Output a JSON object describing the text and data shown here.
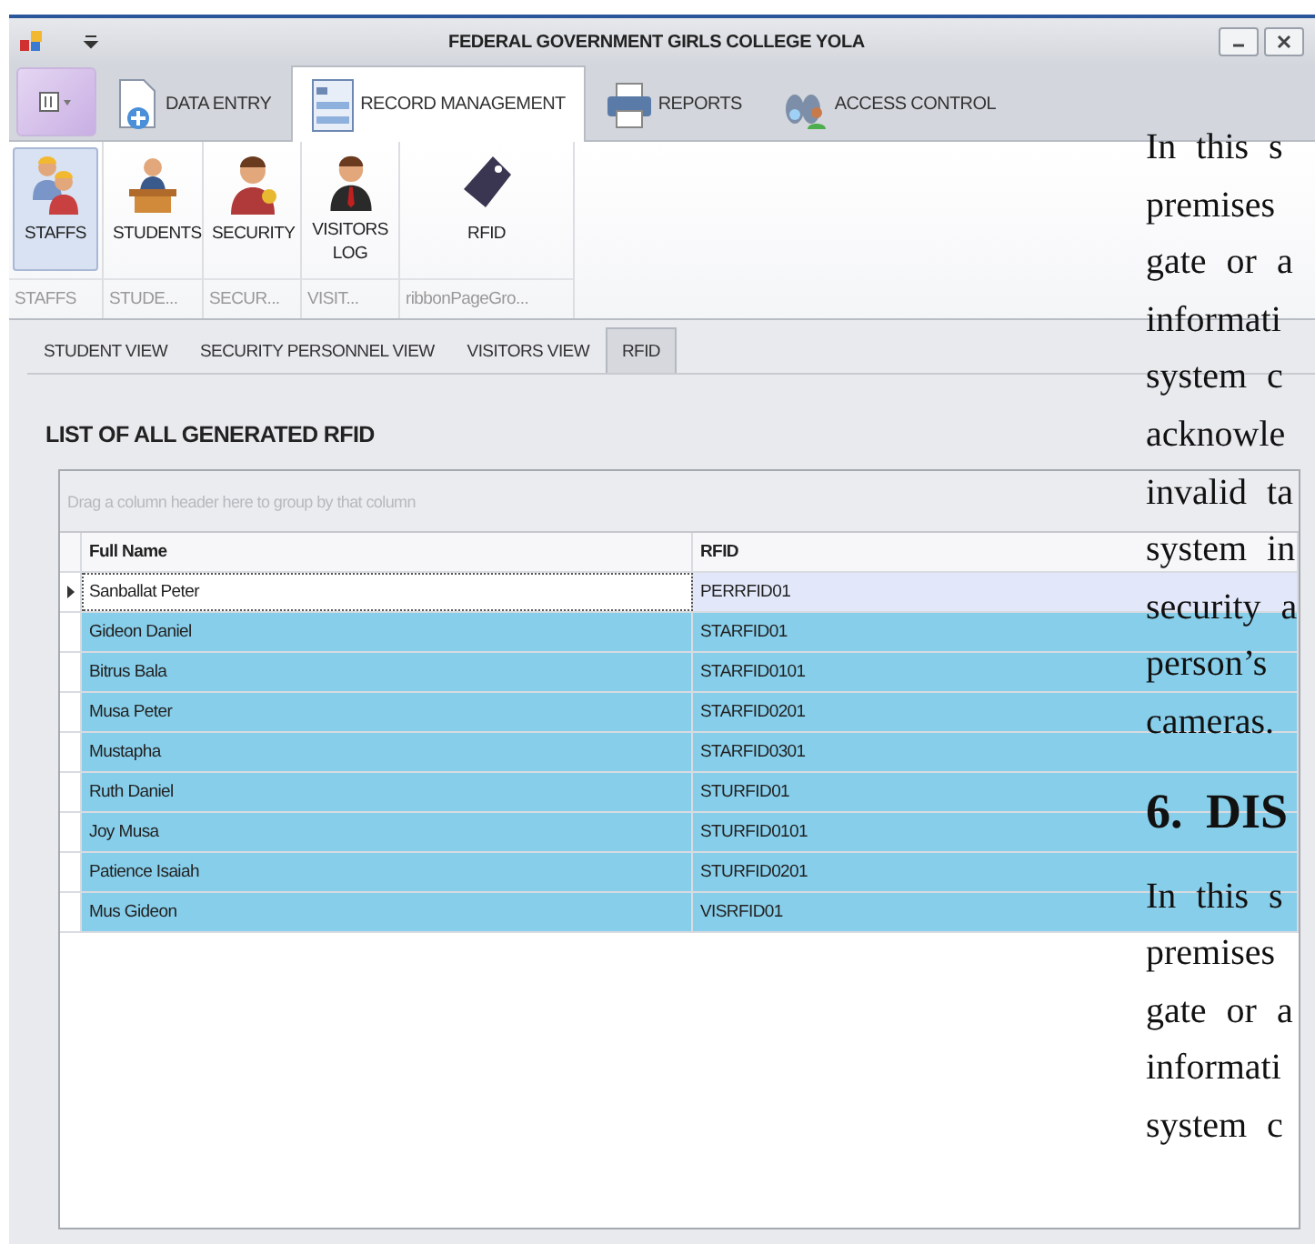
{
  "window": {
    "title": "FEDERAL GOVERNMENT GIRLS COLLEGE YOLA"
  },
  "ribbon": {
    "tabs": [
      {
        "label": "DATA ENTRY",
        "selected": false
      },
      {
        "label": "RECORD MANAGEMENT",
        "selected": true
      },
      {
        "label": "REPORTS",
        "selected": false
      },
      {
        "label": "ACCESS CONTROL",
        "selected": false
      }
    ],
    "buttons": [
      {
        "label": "STAFFS",
        "selected": true
      },
      {
        "label": "STUDENTS",
        "selected": false
      },
      {
        "label": "SECURITY",
        "selected": false
      },
      {
        "label": "VISITORS LOG",
        "selected": false
      },
      {
        "label": "RFID",
        "selected": false
      }
    ],
    "groups": [
      "STAFFS",
      "STUDE...",
      "SECUR...",
      "VISIT...",
      "ribbonPageGro..."
    ]
  },
  "view_tabs": [
    {
      "label": "STUDENT VIEW",
      "selected": false
    },
    {
      "label": "SECURITY PERSONNEL VIEW",
      "selected": false
    },
    {
      "label": "VISITORS VIEW",
      "selected": false
    },
    {
      "label": "RFID",
      "selected": true
    }
  ],
  "heading": "LIST OF ALL GENERATED RFID",
  "grid": {
    "group_panel": {
      "placeholder": "Drag a column header here to group by that column"
    },
    "columns": [
      "Full Name",
      "RFID"
    ],
    "rows": [
      {
        "cells": [
          "Sanballat Peter",
          "PERRFID01"
        ],
        "focused": true,
        "selected": false
      },
      {
        "cells": [
          "Gideon Daniel",
          "STARFID01"
        ],
        "focused": false,
        "selected": true
      },
      {
        "cells": [
          "Bitrus Bala",
          "STARFID0101"
        ],
        "focused": false,
        "selected": true
      },
      {
        "cells": [
          "Musa Peter",
          "STARFID0201"
        ],
        "focused": false,
        "selected": true
      },
      {
        "cells": [
          "Mustapha",
          "STARFID0301"
        ],
        "focused": false,
        "selected": true
      },
      {
        "cells": [
          "Ruth Daniel",
          "STURFID01"
        ],
        "focused": false,
        "selected": true
      },
      {
        "cells": [
          "Joy Musa",
          "STURFID0101"
        ],
        "focused": false,
        "selected": true
      },
      {
        "cells": [
          "Patience Isaiah",
          "STURFID0201"
        ],
        "focused": false,
        "selected": true
      },
      {
        "cells": [
          "Mus Gideon",
          "VISRFID01"
        ],
        "focused": false,
        "selected": true
      }
    ]
  },
  "document_overlay": {
    "lines": [
      {
        "kind": "text",
        "text": "In this s"
      },
      {
        "kind": "text",
        "text": "premises"
      },
      {
        "kind": "text",
        "text": "gate or a"
      },
      {
        "kind": "text",
        "text": "informati"
      },
      {
        "kind": "text",
        "text": "system c"
      },
      {
        "kind": "text",
        "text": "acknowle"
      },
      {
        "kind": "text",
        "text": "invalid ta"
      },
      {
        "kind": "text",
        "text": "system in"
      },
      {
        "kind": "text",
        "text": "security a"
      },
      {
        "kind": "text",
        "text": "person’s"
      },
      {
        "kind": "text",
        "text": "cameras."
      },
      {
        "kind": "heading",
        "text": "6. DIS"
      },
      {
        "kind": "text",
        "text": "In this s"
      },
      {
        "kind": "text",
        "text": "premises"
      },
      {
        "kind": "text",
        "text": "gate or a"
      },
      {
        "kind": "text",
        "text": "informati"
      },
      {
        "kind": "text",
        "text": "system c"
      }
    ]
  }
}
